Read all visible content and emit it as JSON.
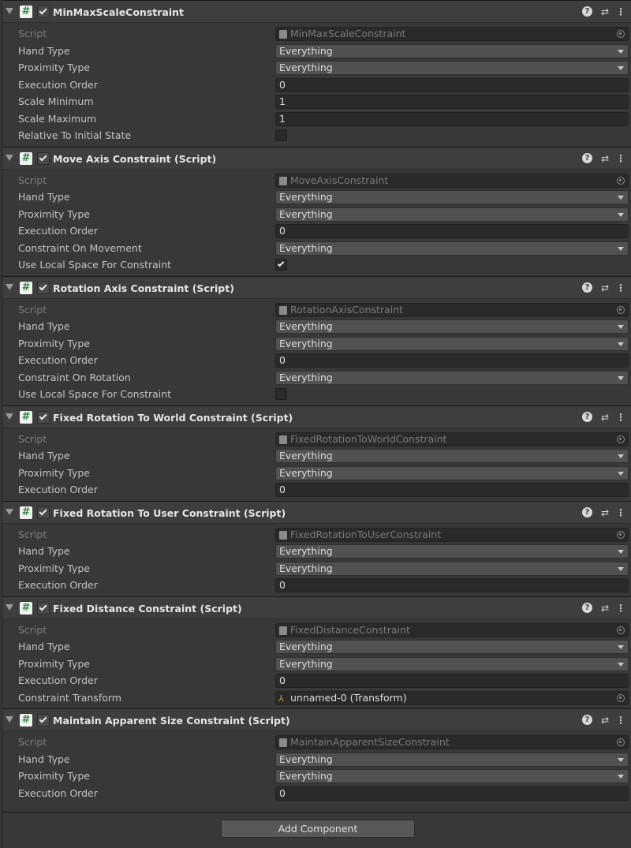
{
  "components": [
    {
      "title": "MinMaxScaleConstraint",
      "rows": [
        {
          "label": "Script",
          "type": "script",
          "value": "MinMaxScaleConstraint"
        },
        {
          "label": "Hand Type",
          "type": "dropdown",
          "value": "Everything"
        },
        {
          "label": "Proximity Type",
          "type": "dropdown",
          "value": "Everything"
        },
        {
          "label": "Execution Order",
          "type": "field",
          "value": "0"
        },
        {
          "label": "Scale Minimum",
          "type": "field",
          "value": "1"
        },
        {
          "label": "Scale Maximum",
          "type": "field",
          "value": "1"
        },
        {
          "label": "Relative To Initial State",
          "type": "toggle",
          "checked": false
        }
      ]
    },
    {
      "title": "Move Axis Constraint (Script)",
      "rows": [
        {
          "label": "Script",
          "type": "script",
          "value": "MoveAxisConstraint"
        },
        {
          "label": "Hand Type",
          "type": "dropdown",
          "value": "Everything"
        },
        {
          "label": "Proximity Type",
          "type": "dropdown",
          "value": "Everything"
        },
        {
          "label": "Execution Order",
          "type": "field",
          "value": "0"
        },
        {
          "label": "Constraint On Movement",
          "type": "dropdown",
          "value": "Everything"
        },
        {
          "label": "Use Local Space For Constraint",
          "type": "toggle",
          "checked": true
        }
      ]
    },
    {
      "title": "Rotation Axis Constraint (Script)",
      "rows": [
        {
          "label": "Script",
          "type": "script",
          "value": "RotationAxisConstraint"
        },
        {
          "label": "Hand Type",
          "type": "dropdown",
          "value": "Everything"
        },
        {
          "label": "Proximity Type",
          "type": "dropdown",
          "value": "Everything"
        },
        {
          "label": "Execution Order",
          "type": "field",
          "value": "0"
        },
        {
          "label": "Constraint On Rotation",
          "type": "dropdown",
          "value": "Everything"
        },
        {
          "label": "Use Local Space For Constraint",
          "type": "toggle",
          "checked": false
        }
      ]
    },
    {
      "title": "Fixed Rotation To World Constraint (Script)",
      "rows": [
        {
          "label": "Script",
          "type": "script",
          "value": "FixedRotationToWorldConstraint"
        },
        {
          "label": "Hand Type",
          "type": "dropdown",
          "value": "Everything"
        },
        {
          "label": "Proximity Type",
          "type": "dropdown",
          "value": "Everything"
        },
        {
          "label": "Execution Order",
          "type": "field",
          "value": "0"
        }
      ]
    },
    {
      "title": "Fixed Rotation To User Constraint (Script)",
      "rows": [
        {
          "label": "Script",
          "type": "script",
          "value": "FixedRotationToUserConstraint"
        },
        {
          "label": "Hand Type",
          "type": "dropdown",
          "value": "Everything"
        },
        {
          "label": "Proximity Type",
          "type": "dropdown",
          "value": "Everything"
        },
        {
          "label": "Execution Order",
          "type": "field",
          "value": "0"
        }
      ]
    },
    {
      "title": "Fixed Distance Constraint (Script)",
      "rows": [
        {
          "label": "Script",
          "type": "script",
          "value": "FixedDistanceConstraint"
        },
        {
          "label": "Hand Type",
          "type": "dropdown",
          "value": "Everything"
        },
        {
          "label": "Proximity Type",
          "type": "dropdown",
          "value": "Everything"
        },
        {
          "label": "Execution Order",
          "type": "field",
          "value": "0"
        },
        {
          "label": "Constraint Transform",
          "type": "object",
          "value": "unnamed-0 (Transform)"
        }
      ]
    },
    {
      "title": "Maintain Apparent Size Constraint (Script)",
      "rows": [
        {
          "label": "Script",
          "type": "script",
          "value": "MaintainApparentSizeConstraint"
        },
        {
          "label": "Hand Type",
          "type": "dropdown",
          "value": "Everything"
        },
        {
          "label": "Proximity Type",
          "type": "dropdown",
          "value": "Everything"
        },
        {
          "label": "Execution Order",
          "type": "field",
          "value": "0"
        }
      ]
    }
  ],
  "icons": {
    "script": "script-hash-icon",
    "help": "help-icon",
    "presets": "presets-icon",
    "menu": "kebab-menu-icon"
  },
  "add_component_label": "Add Component"
}
